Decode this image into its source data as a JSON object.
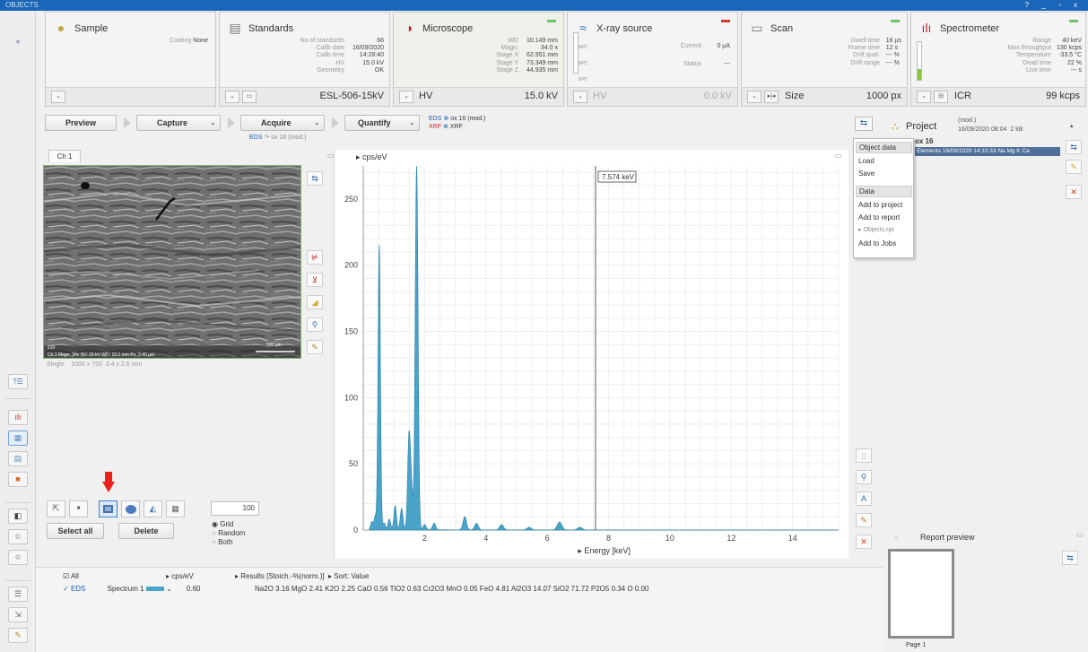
{
  "titlebar": {
    "title": "OBJECTS",
    "controls": "? _ ▫ x"
  },
  "panels": {
    "sample": {
      "title": "Sample",
      "coating_label": "Coating",
      "coating_value": "None"
    },
    "standards": {
      "title": "Standards",
      "labels": [
        "No of standards",
        "Calib date",
        "Calib time",
        "HV",
        "Geometry"
      ],
      "values": [
        "66",
        "16/09/2020",
        "14:28:40",
        "15.0 kV",
        "OK"
      ],
      "footer": "ESL-506-15kV"
    },
    "microscope": {
      "title": "Microscope",
      "labels": [
        "WD",
        "Magn.",
        "Stage X",
        "Stage Y",
        "Stage Z"
      ],
      "values": [
        "10.149 mm",
        "34.0 x",
        "62.951 mm",
        "73.349 mm",
        "44.935 mm"
      ],
      "footer_label": "HV",
      "footer_value": "15.0 kV"
    },
    "xray": {
      "title": "X-ray source",
      "labels": [
        "Current",
        "Status"
      ],
      "values": [
        "0 µA",
        "---"
      ],
      "gauge_labels": [
        "BPC",
        "BPC",
        "BPC"
      ],
      "footer_label": "HV",
      "footer_value": "0.0 kV"
    },
    "scan": {
      "title": "Scan",
      "labels": [
        "Dwell time",
        "Frame time",
        "Drift qual.",
        "Drift range"
      ],
      "values": [
        "16 µs",
        "12 s",
        "--- %",
        "--- %"
      ],
      "footer_label": "Size",
      "footer_value": "1000 px"
    },
    "spectrometer": {
      "title": "Spectrometer",
      "labels": [
        "Range",
        "Max.throughput",
        "Temperature",
        "Dead time",
        "Live time"
      ],
      "values": [
        "40 keV",
        "130 kcps",
        "-33.5 °C",
        "22 %",
        "--- s"
      ],
      "footer_label": "ICR",
      "footer_value": "99 kcps"
    }
  },
  "actions": {
    "preview": "Preview",
    "capture": "Capture",
    "acquire": "Acquire",
    "quantify": "Quantify",
    "eds_label": "EDS",
    "mode": "ox 16 (mod.)",
    "eds_mode": "ox 16 (mod.)",
    "xrf_label": "XRF",
    "xrf_mode": "XRF"
  },
  "image": {
    "tab": "Ch 1",
    "info_left": "Single",
    "info_res": "1000 x 750",
    "info_size": "3.4 x 2.6 mm",
    "scalebar": "500 µm",
    "overlay_text": "Ch 1  Magn: 34x  HV: 15 kV  WD: 10.1 mm  Px: 3.40 µm",
    "overlay_mag": "210"
  },
  "tools": {
    "count": "100",
    "options": [
      "Grid",
      "Random",
      "Both"
    ],
    "select_all": "Select all",
    "delete": "Delete"
  },
  "chart_data": {
    "type": "line",
    "title": "",
    "ylabel": "cps/eV",
    "xlabel": "Energy [keV]",
    "xlim": [
      0,
      15.5
    ],
    "ylim": [
      0,
      275
    ],
    "xticks": [
      2,
      4,
      6,
      8,
      10,
      12,
      14
    ],
    "yticks": [
      0,
      50,
      100,
      150,
      200,
      250
    ],
    "cursor": {
      "x": 7.574,
      "label": "7.574 keV"
    },
    "series": [
      {
        "peaks": [
          [
            0.28,
            6
          ],
          [
            0.39,
            10
          ],
          [
            0.52,
            215
          ],
          [
            0.68,
            5
          ],
          [
            0.85,
            8
          ],
          [
            1.04,
            18
          ],
          [
            1.25,
            16
          ],
          [
            1.49,
            68
          ],
          [
            1.57,
            30
          ],
          [
            1.74,
            275
          ],
          [
            2.0,
            4
          ],
          [
            2.31,
            5
          ],
          [
            3.31,
            10
          ],
          [
            3.69,
            5
          ],
          [
            4.51,
            4
          ],
          [
            5.41,
            2
          ],
          [
            6.4,
            6
          ],
          [
            7.06,
            2
          ]
        ]
      }
    ]
  },
  "menu": {
    "header1": "Object data",
    "items1": [
      "Load",
      "Save"
    ],
    "header2": "Data",
    "items2": [
      "Add to project",
      "Add to report",
      "Objects.rpt",
      "Add to Jobs"
    ]
  },
  "project": {
    "title": "Project",
    "mod": "(mod.)",
    "date": "16/09/2020 08:04",
    "size": "2 kB",
    "item": "ox 16",
    "row": "Elements 16/09/2020 14:10:33  Na Mg K Ca"
  },
  "results": {
    "all_label": "All",
    "unit_label": "cps/eV",
    "results_label": "Results [Stoich.-%(norm.)]",
    "sort_label": "Sort: Value",
    "row_type": "EDS",
    "row_name": "Spectrum 1",
    "row_value": "0.60",
    "values": "Na2O 3.16  MgO 2.41  K2O 2.25  CaO 0.56  TiO2 0.63  Cr2O3  MnO 0.05  FeO 4.81  Al2O3 14.07  SiO2 71.72  P2O5 0.34  O 0.00"
  },
  "report": {
    "title": "Report preview",
    "page": "Page 1"
  },
  "colors": {
    "spectrum": "#4aa3c9",
    "accent": "#1f5fb0",
    "arrow": "#e8221a"
  }
}
